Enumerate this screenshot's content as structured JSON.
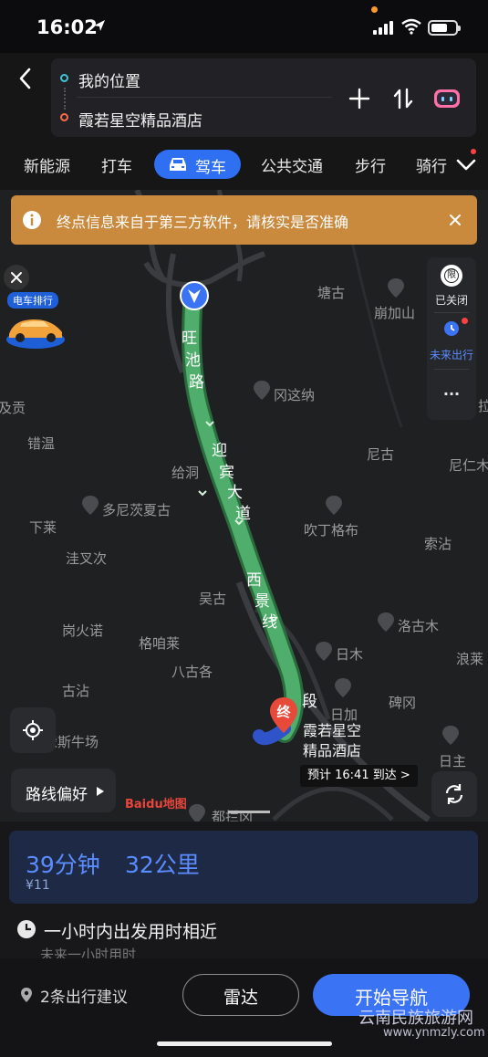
{
  "status_bar": {
    "time": "16:02"
  },
  "header": {
    "origin": "我的位置",
    "destination": "霞若星空精品酒店"
  },
  "tabs": [
    {
      "label": "新能源"
    },
    {
      "label": "打车"
    },
    {
      "label": "驾车",
      "active": true
    },
    {
      "label": "公共交通"
    },
    {
      "label": "步行"
    },
    {
      "label": "骑行"
    }
  ],
  "warning": {
    "text": "终点信息来自于第三方软件，请核实是否准确"
  },
  "ad": {
    "tag": "电车排行"
  },
  "right_panel": {
    "limit_char": "限",
    "limit_label": "已关闭",
    "future_label": "未来出行",
    "more_label": "···"
  },
  "map": {
    "places": [
      {
        "name": "塘古"
      },
      {
        "name": "崩加山"
      },
      {
        "name": "冈这纳"
      },
      {
        "name": "及贡"
      },
      {
        "name": "拉"
      },
      {
        "name": "错温"
      },
      {
        "name": "尼古"
      },
      {
        "name": "尼仁木"
      },
      {
        "name": "给洞"
      },
      {
        "name": "多尼茨夏古"
      },
      {
        "name": "吹丁格布"
      },
      {
        "name": "下莱"
      },
      {
        "name": "洼叉次"
      },
      {
        "name": "索沾"
      },
      {
        "name": "吴古"
      },
      {
        "name": "洛古木"
      },
      {
        "name": "岗火诺"
      },
      {
        "name": "格咱莱"
      },
      {
        "name": "日木"
      },
      {
        "name": "浪莱"
      },
      {
        "name": "八古各"
      },
      {
        "name": "古沾"
      },
      {
        "name": "日加"
      },
      {
        "name": "碑冈"
      },
      {
        "name": "汞斯牛场"
      },
      {
        "name": "日主"
      },
      {
        "name": "都拦冈"
      }
    ],
    "road_labels": [
      "旺",
      "池",
      "路",
      "迎",
      "宾",
      "大",
      "道",
      "西",
      "景",
      "线",
      "段"
    ],
    "dest_marker": "终",
    "dest_name_line1": "霞若星空",
    "dest_name_line2": "精品酒店",
    "eta_tip": "预计 16:41 到达 >",
    "route_pref": "路线偏好",
    "baidu_logo": "Baidu地图"
  },
  "summary": {
    "duration": "39分钟",
    "distance": "32公里",
    "fee": "¥11"
  },
  "tip": {
    "text": "一小时内出发用时相近",
    "sub": "未来一小时用时"
  },
  "bottom": {
    "suggestion": "2条出行建议",
    "radar": "雷达",
    "start_nav": "开始导航"
  },
  "watermark": {
    "line1": "云南民族旅游网",
    "line2": "www.ynmzly.com"
  },
  "colors": {
    "accent": "#3a74f5",
    "route_green": "#4fae6b",
    "warning_bg": "#c98a3e",
    "dest_red": "#e84a3a"
  }
}
